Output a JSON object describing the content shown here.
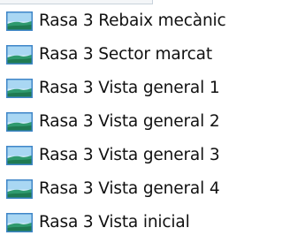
{
  "file_list": {
    "items": [
      {
        "label": "Rasa 3 Rebaix mecànic",
        "icon": "image-file-icon"
      },
      {
        "label": "Rasa 3 Sector marcat",
        "icon": "image-file-icon"
      },
      {
        "label": "Rasa 3 Vista general 1",
        "icon": "image-file-icon"
      },
      {
        "label": "Rasa 3 Vista general 2",
        "icon": "image-file-icon"
      },
      {
        "label": "Rasa 3 Vista general 3",
        "icon": "image-file-icon"
      },
      {
        "label": "Rasa 3 Vista general 4",
        "icon": "image-file-icon"
      },
      {
        "label": "Rasa 3 Vista inicial",
        "icon": "image-file-icon"
      }
    ]
  },
  "colors": {
    "text": "#111111",
    "background": "#ffffff",
    "icon_frame": "#3f86c8",
    "icon_sky": "#bfe3f7",
    "icon_land": "#2e9a6e"
  }
}
